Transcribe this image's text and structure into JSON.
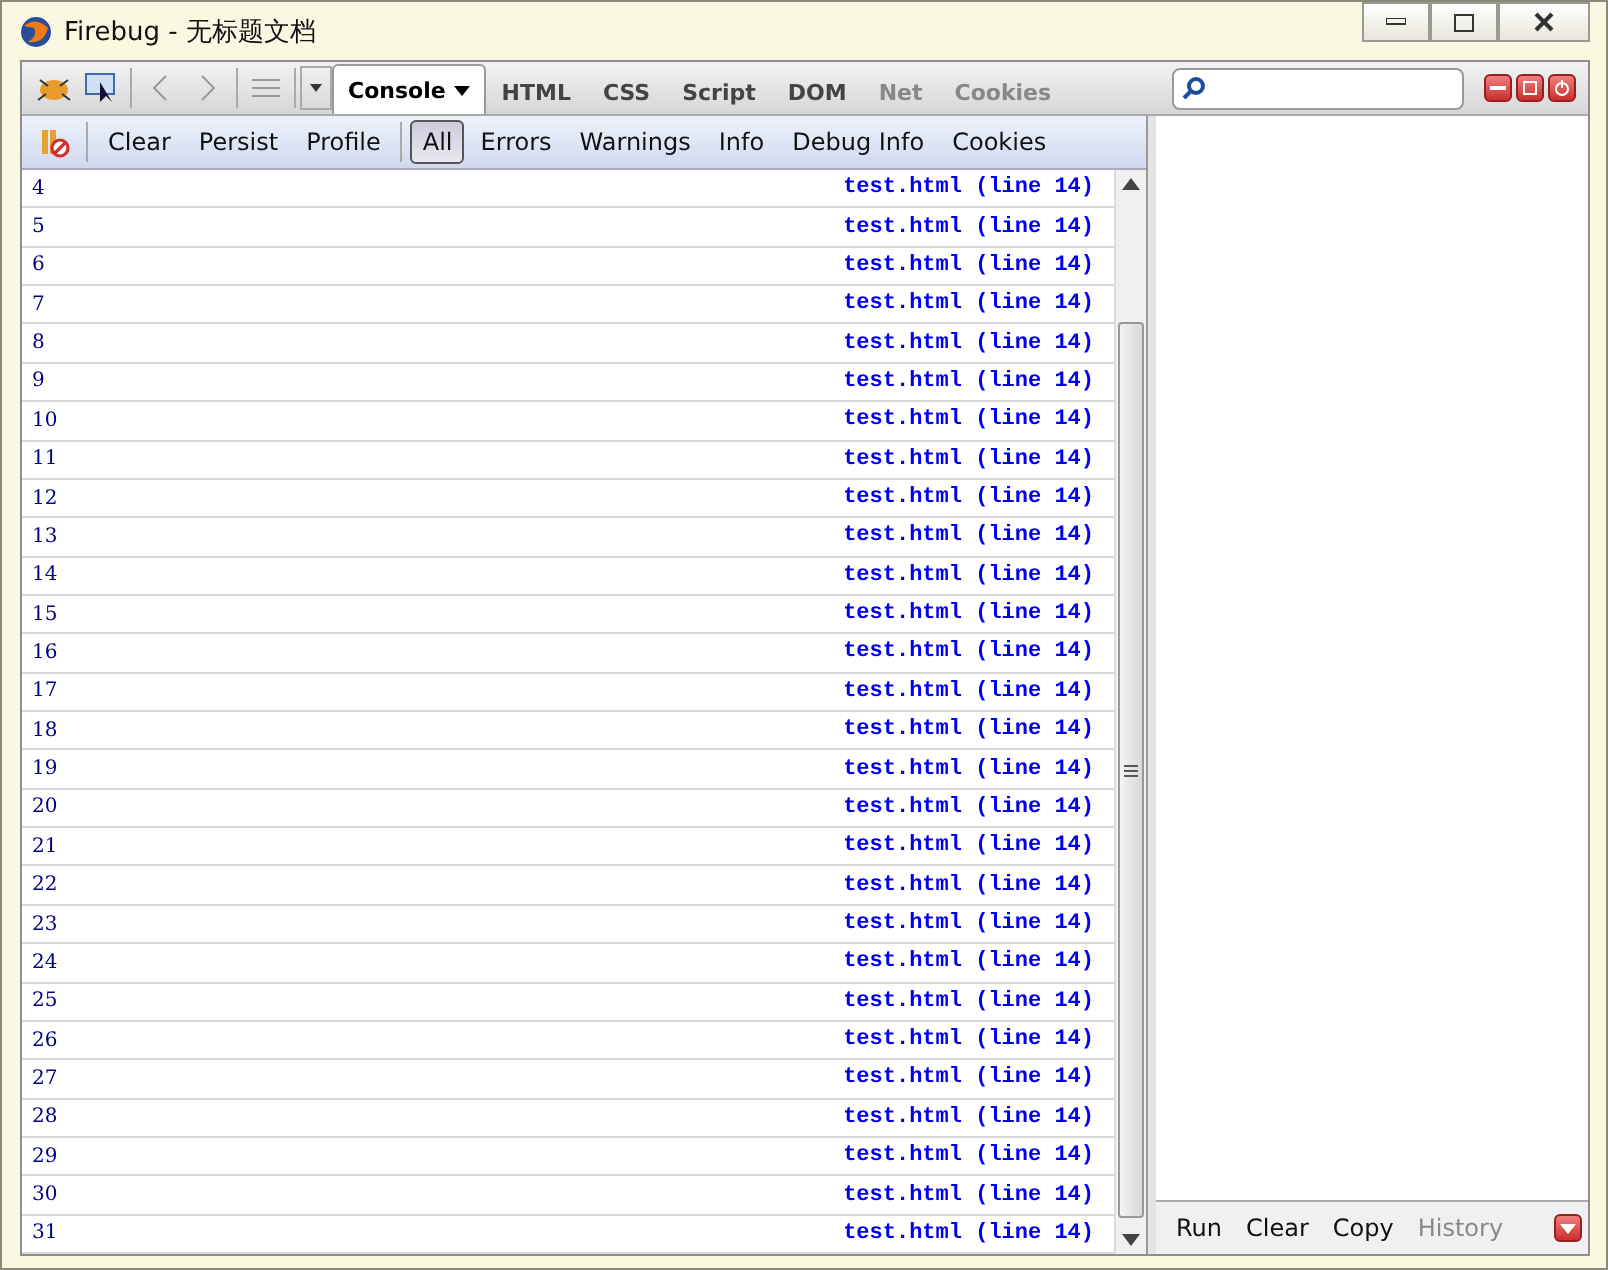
{
  "window": {
    "title": "Firebug - 无标题文档"
  },
  "tabs": [
    {
      "label": "Console",
      "selected": true,
      "disabled": false,
      "dropdown": true
    },
    {
      "label": "HTML",
      "selected": false,
      "disabled": false
    },
    {
      "label": "CSS",
      "selected": false,
      "disabled": false
    },
    {
      "label": "Script",
      "selected": false,
      "disabled": false
    },
    {
      "label": "DOM",
      "selected": false,
      "disabled": false
    },
    {
      "label": "Net",
      "selected": false,
      "disabled": true
    },
    {
      "label": "Cookies",
      "selected": false,
      "disabled": true
    }
  ],
  "console_actions": [
    "Clear",
    "Persist",
    "Profile"
  ],
  "filters": [
    {
      "label": "All",
      "selected": true
    },
    {
      "label": "Errors",
      "selected": false
    },
    {
      "label": "Warnings",
      "selected": false
    },
    {
      "label": "Info",
      "selected": false
    },
    {
      "label": "Debug Info",
      "selected": false
    },
    {
      "label": "Cookies",
      "selected": false
    }
  ],
  "log_rows": [
    {
      "message": "4",
      "source": "test.html (line 14)"
    },
    {
      "message": "5",
      "source": "test.html (line 14)"
    },
    {
      "message": "6",
      "source": "test.html (line 14)"
    },
    {
      "message": "7",
      "source": "test.html (line 14)"
    },
    {
      "message": "8",
      "source": "test.html (line 14)"
    },
    {
      "message": "9",
      "source": "test.html (line 14)"
    },
    {
      "message": "10",
      "source": "test.html (line 14)"
    },
    {
      "message": "11",
      "source": "test.html (line 14)"
    },
    {
      "message": "12",
      "source": "test.html (line 14)"
    },
    {
      "message": "13",
      "source": "test.html (line 14)"
    },
    {
      "message": "14",
      "source": "test.html (line 14)"
    },
    {
      "message": "15",
      "source": "test.html (line 14)"
    },
    {
      "message": "16",
      "source": "test.html (line 14)"
    },
    {
      "message": "17",
      "source": "test.html (line 14)"
    },
    {
      "message": "18",
      "source": "test.html (line 14)"
    },
    {
      "message": "19",
      "source": "test.html (line 14)"
    },
    {
      "message": "20",
      "source": "test.html (line 14)"
    },
    {
      "message": "21",
      "source": "test.html (line 14)"
    },
    {
      "message": "22",
      "source": "test.html (line 14)"
    },
    {
      "message": "23",
      "source": "test.html (line 14)"
    },
    {
      "message": "24",
      "source": "test.html (line 14)"
    },
    {
      "message": "25",
      "source": "test.html (line 14)"
    },
    {
      "message": "26",
      "source": "test.html (line 14)"
    },
    {
      "message": "27",
      "source": "test.html (line 14)"
    },
    {
      "message": "28",
      "source": "test.html (line 14)"
    },
    {
      "message": "29",
      "source": "test.html (line 14)"
    },
    {
      "message": "30",
      "source": "test.html (line 14)"
    },
    {
      "message": "31",
      "source": "test.html (line 14)"
    }
  ],
  "command_bar": [
    {
      "label": "Run",
      "disabled": false
    },
    {
      "label": "Clear",
      "disabled": false
    },
    {
      "label": "Copy",
      "disabled": false
    },
    {
      "label": "History",
      "disabled": true
    }
  ]
}
